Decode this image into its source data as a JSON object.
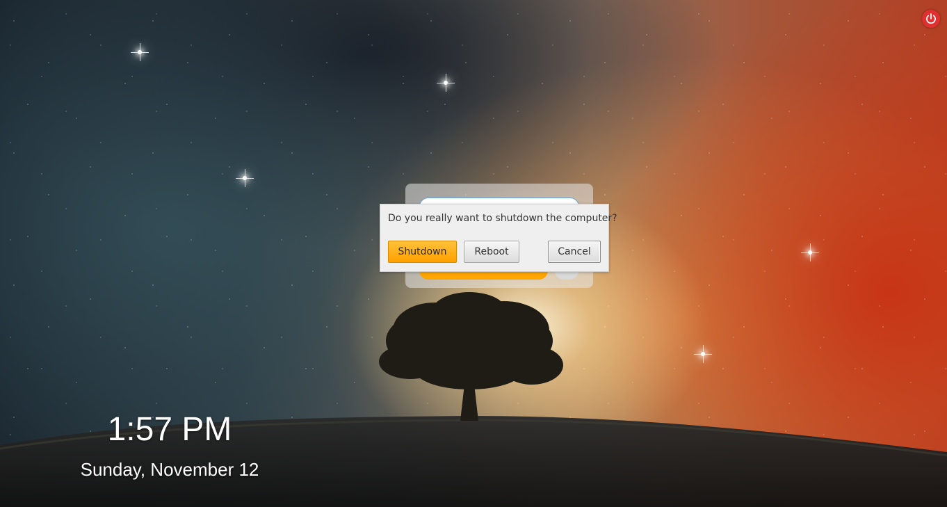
{
  "screen": {
    "wallpaper": "starry-sky-with-tree",
    "colors": {
      "accent": "#ffa500",
      "power": "#e03030"
    }
  },
  "power_button": {
    "icon": "power-icon"
  },
  "dialog": {
    "message": "Do you really want to shutdown the computer?",
    "shutdown_label": "Shutdown",
    "reboot_label": "Reboot",
    "cancel_label": "Cancel"
  },
  "clock": {
    "time": "1:57 PM",
    "date": "Sunday, November 12"
  }
}
